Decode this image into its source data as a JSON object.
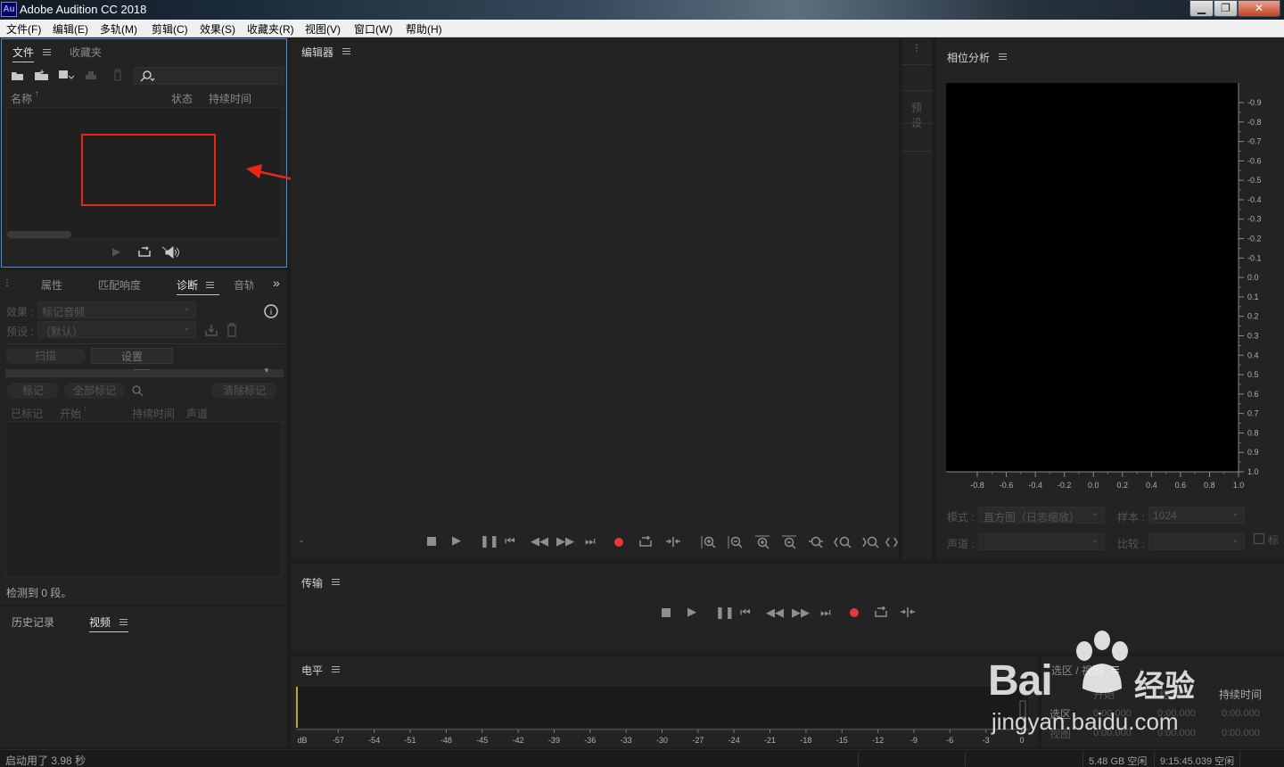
{
  "app": {
    "icon_text": "Au",
    "title": "Adobe Audition CC 2018"
  },
  "window_controls": {
    "minimize": "▁",
    "maximize": "❐",
    "close": "✕"
  },
  "menu": [
    "文件(F)",
    "编辑(E)",
    "多轨(M)",
    "剪辑(C)",
    "效果(S)",
    "收藏夹(R)",
    "视图(V)",
    "窗口(W)",
    "帮助(H)"
  ],
  "files_panel": {
    "tabs": [
      "文件",
      "收藏夹"
    ],
    "columns": {
      "name": "名称",
      "status": "状态",
      "duration": "持续时间"
    }
  },
  "diagnostics_panel": {
    "tabs": [
      "属性",
      "匹配响度",
      "诊断",
      "音轨"
    ],
    "effect_label": "效果 :",
    "effect_value": "标记音频",
    "preset_label": "预设 :",
    "preset_value": "（默认）",
    "scan_button": "扫描",
    "settings_button": "设置",
    "mark_button": "标记",
    "mark_all_button": "全部标记",
    "clear_marks_button": "清除标记",
    "columns": [
      "已标记",
      "开始",
      "持续时间",
      "声道"
    ],
    "status": "检测到 0 段。"
  },
  "history_panel": {
    "tabs": [
      "历史记录",
      "视频"
    ]
  },
  "editor_panel": {
    "title": "编辑器",
    "time_display": "-"
  },
  "presets_strip": {
    "label": "预设"
  },
  "phase_panel": {
    "title": "相位分析",
    "mode_label": "模式 :",
    "mode_value": "直方图（日志缩放）",
    "sample_label": "样本 :",
    "sample_value": "1024",
    "channel_label": "声道 :",
    "channel_value": "",
    "compare_label": "比较 :",
    "compare_value": "",
    "checkbox_label": "标"
  },
  "transport_panel": {
    "title": "传输"
  },
  "levels_panel": {
    "title": "电平"
  },
  "selection_panel": {
    "title": "选区 / 视图",
    "col_start": "开始",
    "col_end": "结束",
    "col_duration": "持续时间",
    "row_selection": "选区",
    "row_view": "视图",
    "sel_start": "0:00.000",
    "sel_end": "0:00.000",
    "sel_duration": "0:00.000",
    "view_start": "0:00.000",
    "view_end": "0:00.000",
    "view_duration": "0:00.000"
  },
  "statusbar": {
    "startup": "启动用了 3.98 秒",
    "disk": "5.48 GB 空闲",
    "time_free": "9:15:45.039 空闲"
  },
  "watermark": "Bai 经验 jingyan.baidu.com",
  "colors": {
    "record": "#e8383d",
    "annotation": "#e8261a",
    "selection_border": "#4a90d9",
    "meter_cursor": "#e6d23a"
  },
  "chart_data": [
    {
      "type": "histogram",
      "y_ticks": [
        "-0.9",
        "-0.8",
        "-0.7",
        "-0.6",
        "-0.5",
        "-0.4",
        "-0.3",
        "-0.2",
        "-0.1",
        "0.0",
        "0.1",
        "0.2",
        "0.3",
        "0.4",
        "0.5",
        "0.6",
        "0.7",
        "0.8",
        "0.9",
        "1.0"
      ],
      "x_ticks": [
        "-0.8",
        "-0.6",
        "-0.4",
        "-0.2",
        "0.0",
        "0.2",
        "0.4",
        "0.6",
        "0.8",
        "1.0"
      ],
      "values": []
    },
    {
      "type": "meter",
      "x_ticks": [
        "dB",
        "-57",
        "-54",
        "-51",
        "-48",
        "-45",
        "-42",
        "-39",
        "-36",
        "-33",
        "-30",
        "-27",
        "-24",
        "-21",
        "-18",
        "-15",
        "-12",
        "-9",
        "-6",
        "-3",
        "0"
      ],
      "values": []
    }
  ]
}
